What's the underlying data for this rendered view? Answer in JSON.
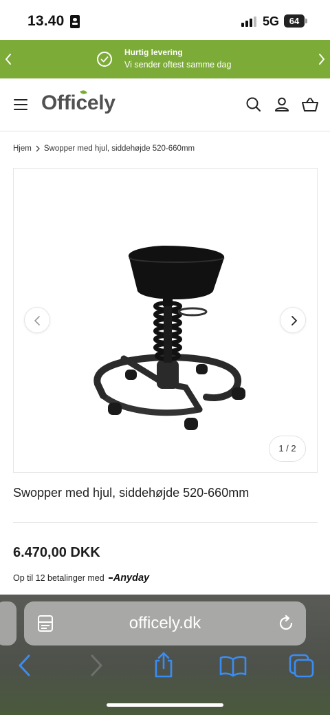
{
  "status": {
    "time": "13.40",
    "network": "5G",
    "battery": "64"
  },
  "promo": {
    "title": "Hurtig levering",
    "subtitle": "Vi sender oftest samme dag",
    "prev_icon": "chevron-left-icon",
    "next_icon": "chevron-right-icon"
  },
  "header": {
    "logo": "Officely",
    "icons": [
      "menu-icon",
      "search-icon",
      "account-icon",
      "basket-icon"
    ]
  },
  "breadcrumb": {
    "home": "Hjem",
    "current": "Swopper med hjul, siddehøjde 520-660mm"
  },
  "gallery": {
    "counter": "1 / 2"
  },
  "product": {
    "title": "Swopper med hjul, siddehøjde 520-660mm",
    "price": "6.470,00 DKK",
    "financing_text": "Op til 12 betalinger med",
    "financing_provider": "Anyday"
  },
  "browser": {
    "url": "officely.dk",
    "icons": [
      "reader-icon",
      "reload-icon",
      "back-icon",
      "forward-icon",
      "share-icon",
      "bookmarks-icon",
      "tabs-icon"
    ]
  },
  "colors": {
    "accent": "#7dab38",
    "text": "#1f1f1f",
    "safari_bar": "#a8a9a6",
    "toolbar_icon": "#3a8cf5"
  }
}
